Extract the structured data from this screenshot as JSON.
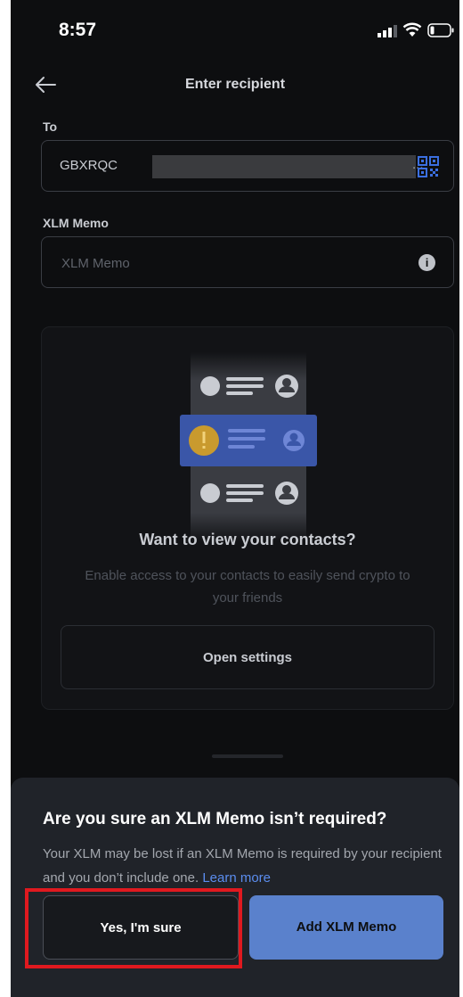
{
  "status_bar": {
    "time": "8:57"
  },
  "header": {
    "title": "Enter recipient",
    "back_icon": "arrow-left-icon"
  },
  "to_field": {
    "label": "To",
    "value": "GBXRQC",
    "ellipsis": "...",
    "qr_icon": "qr-code-icon"
  },
  "memo_field": {
    "label": "XLM Memo",
    "placeholder": "XLM Memo",
    "info_icon": "info-icon"
  },
  "contacts": {
    "title": "Want to view your contacts?",
    "description": "Enable access to your contacts to easily send crypto to your friends",
    "button_label": "Open settings"
  },
  "dialog": {
    "title": "Are you sure an XLM Memo isn’t required?",
    "description": "Your XLM may be lost if an XLM Memo is required by your recipient and you don’t include one.",
    "learn_more": "Learn more",
    "confirm_label": "Yes, I'm sure",
    "add_label": "Add XLM Memo"
  },
  "colors": {
    "background": "#0d0e10",
    "sheet": "#202329",
    "accent_blue": "#5a81cc",
    "link": "#5b8def",
    "highlight_red": "#e0191f"
  }
}
